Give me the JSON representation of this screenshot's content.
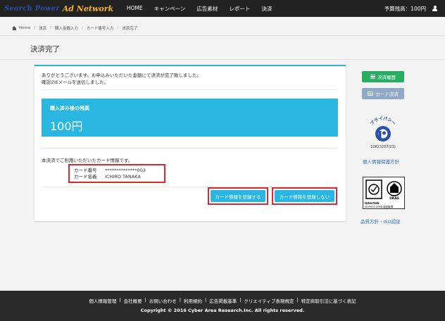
{
  "navbar": {
    "logo_left": "Search Power",
    "logo_right": "Ad Network",
    "items": [
      {
        "label": "HOME"
      },
      {
        "label": "キャンペーン"
      },
      {
        "label": "広告素材"
      },
      {
        "label": "レポート"
      },
      {
        "label": "決済"
      }
    ],
    "balance_label": "予算残高：100円"
  },
  "breadcrumb": {
    "items": [
      {
        "label": "Home"
      },
      {
        "label": "決済"
      },
      {
        "label": "購入金額入力"
      },
      {
        "label": "カード番号入力"
      },
      {
        "label": "決済完了"
      }
    ],
    "separator": "/"
  },
  "page": {
    "title": "決済完了"
  },
  "panel": {
    "message_1": "ありがとうございます。お申込みいただいた金額にて決済が完了致しました。",
    "message_2": "確認のEメールを送信しました。",
    "balance_label": "購入済み後の残高",
    "balance_value": "100円",
    "card_intro": "本決済でご利用いただいたカード情報です。",
    "card_number_label": "カード番号",
    "card_number_value": "**************003",
    "card_name_label": "カード名義",
    "card_name_value": "ICHIRO TANAKA",
    "register_button": "カード情報を登録する",
    "no_register_button": "カード情報を登録しない"
  },
  "sidebar": {
    "history_button": "決済履歴",
    "card_button": "カード決済",
    "privacy_mark_text": "プライバシー",
    "privacy_number": "10823207(03)",
    "privacy_link": "個人情報保護方針",
    "iso_brand": "Intertek",
    "iso_cert": "UKAS",
    "iso_number": "ISO9001:2008  認証取得",
    "iso_link": "品質方針・ISO認証"
  },
  "footer": {
    "links": [
      {
        "label": "個人情報管理"
      },
      {
        "label": "会社概要"
      },
      {
        "label": "お問い合わせ"
      },
      {
        "label": "利用規約"
      },
      {
        "label": "広告掲載基準"
      },
      {
        "label": "クリエイティブ表現規定"
      },
      {
        "label": "特定商取引法に基づく表記"
      }
    ],
    "separator": "|",
    "copyright": "Copyright © 2016 Cyber Area Research.Inc. All rights reserved."
  },
  "colors": {
    "accent": "#29b6e0",
    "navbar": "#222222",
    "highlight_border": "#e0262f",
    "history_button": "#27ae60",
    "card_button": "#8fa9c6",
    "link": "#2a6db0"
  }
}
